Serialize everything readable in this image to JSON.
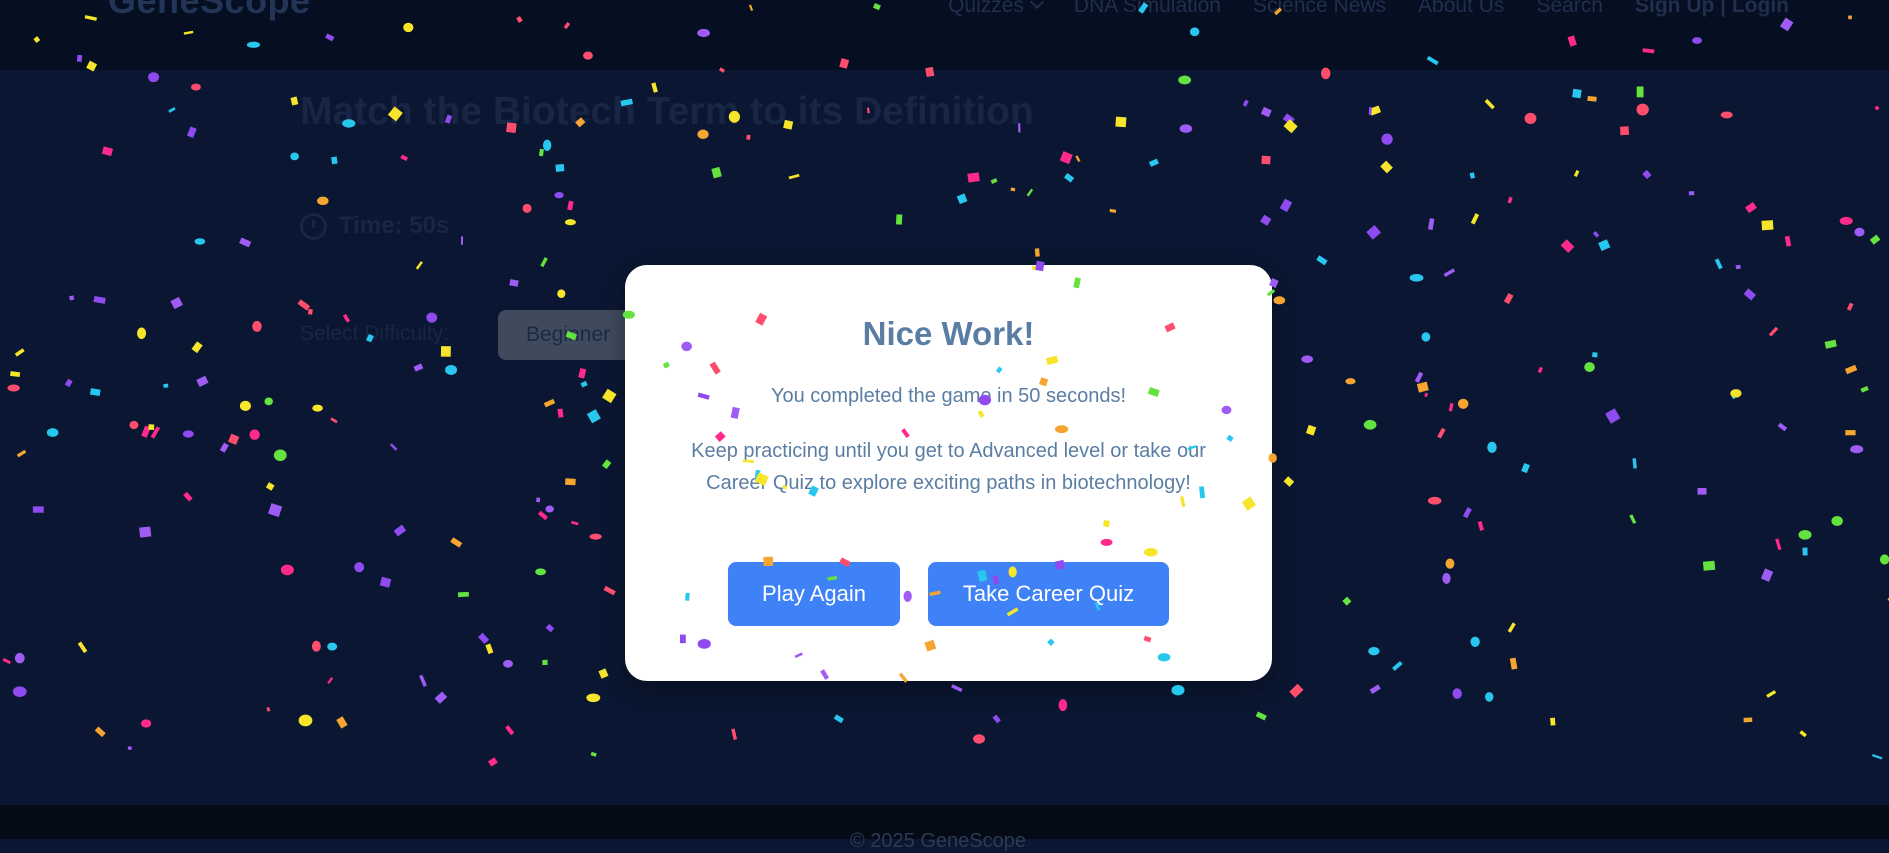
{
  "nav": {
    "brand": "GeneScope",
    "links": [
      {
        "label": "Quizzes",
        "has_dropdown": true
      },
      {
        "label": "DNA Simulation"
      },
      {
        "label": "Science News"
      },
      {
        "label": "About Us"
      },
      {
        "label": "Search"
      },
      {
        "label": "Sign Up | Login",
        "bold": true
      }
    ]
  },
  "main": {
    "title": "Match the Biotech Term to its Definition",
    "timer": "Time: 50s",
    "difficulty_label": "Select Difficulty:",
    "difficulty_value": "Beginner"
  },
  "modal": {
    "title": "Nice Work!",
    "message1": "You completed the game in 50 seconds!",
    "message2": "Keep practicing until you get to Advanced level or take our Career Quiz to explore exciting paths in biotechnology!",
    "play_again": "Play Again",
    "career_quiz": "Take Career Quiz"
  },
  "footer": {
    "text": "© 2025 GeneScope"
  },
  "colors": {
    "background": "#0b1732",
    "navbar": "#060f22",
    "button": "#3f82f7",
    "modal_text": "#5a7ea3",
    "confetti": [
      "#ff2a8a",
      "#9f5cf5",
      "#f6e52a",
      "#27c7f0",
      "#f6a531",
      "#63e240",
      "#ff4d6d",
      "#8f4bf0"
    ]
  }
}
